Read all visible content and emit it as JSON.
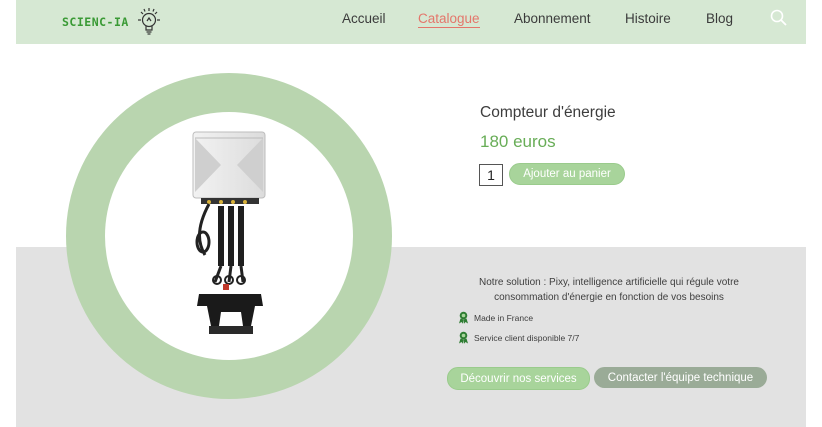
{
  "header": {
    "logo_text": "SCIENC-IA",
    "nav": [
      {
        "label": "Accueil",
        "active": false
      },
      {
        "label": "Catalogue",
        "active": true
      },
      {
        "label": "Abonnement",
        "active": false
      },
      {
        "label": "Histoire",
        "active": false
      },
      {
        "label": "Blog",
        "active": false
      }
    ],
    "search_icon": "search-icon"
  },
  "product": {
    "title": "Compteur d'énergie",
    "price": "180 euros",
    "quantity": "1",
    "add_to_cart_label": "Ajouter au panier"
  },
  "description": {
    "text": "Notre solution : Pixy, intelligence artificielle qui régule votre consommation d'énergie en fonction de vos besoins",
    "features": [
      "Made in France",
      "Service client disponible 7/7"
    ],
    "feature_icon": "award-ribbon-icon"
  },
  "actions": {
    "discover_label": "Découvrir nos services",
    "contact_label": "Contacter l'équipe technique"
  },
  "colors": {
    "header_bg": "#d6e8d3",
    "accent_green": "#68ad57",
    "active_nav": "#e4766b",
    "ring": "#b9d5af",
    "band_gray": "#e2e2e2"
  }
}
